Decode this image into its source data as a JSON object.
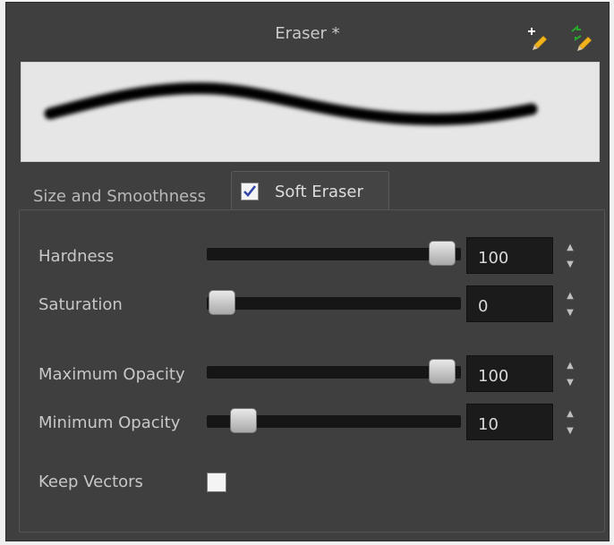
{
  "title": "Eraser *",
  "tabs": [
    {
      "label": "Size and Smoothness",
      "active": false
    },
    {
      "label": "Soft Eraser",
      "active": true,
      "checked": true
    }
  ],
  "params": [
    {
      "label": "Hardness",
      "value": "100",
      "fraction": 1.0
    },
    {
      "label": "Saturation",
      "value": "0",
      "fraction": 0.0
    },
    {
      "label": "Maximum Opacity",
      "value": "100",
      "fraction": 1.0
    },
    {
      "label": "Minimum Opacity",
      "value": "10",
      "fraction": 0.1
    }
  ],
  "keep_vectors": {
    "label": "Keep Vectors",
    "checked": false
  },
  "icons": {
    "new_preset": "pencil-plus-icon",
    "rename_preset": "pencil-arrows-icon",
    "stepper_up": "up-triangle-icon",
    "stepper_down": "down-triangle-icon"
  },
  "colors": {
    "panel": "#3f3f3f",
    "preview_bg": "#e6e6e6",
    "pencil": "#f2b21b",
    "accent_green": "#27a92a"
  }
}
